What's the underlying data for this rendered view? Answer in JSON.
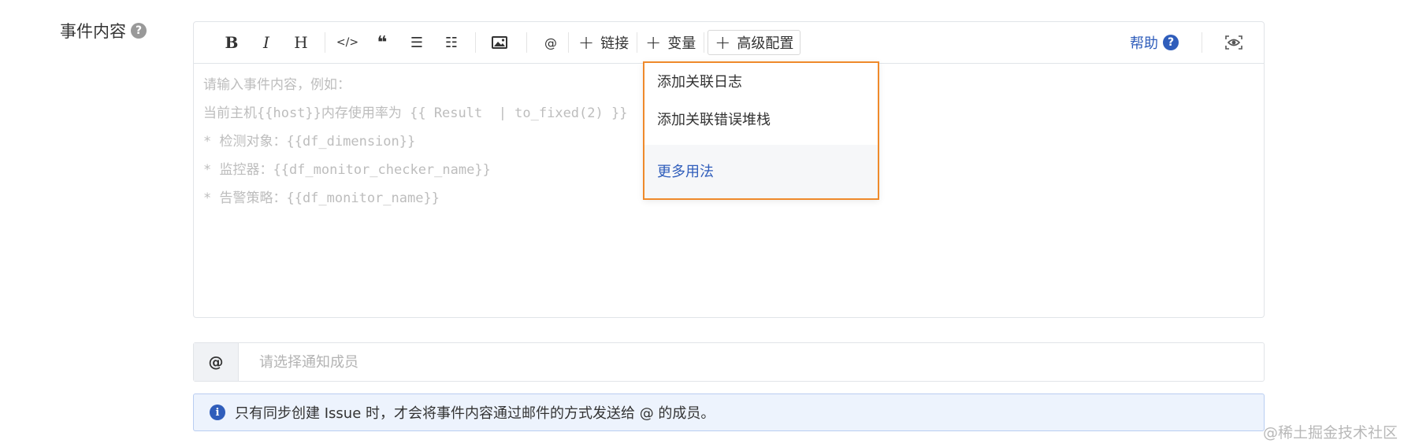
{
  "field": {
    "label": "事件内容",
    "help_glyph": "?"
  },
  "toolbar": {
    "bold": "B",
    "italic": "I",
    "heading": "H",
    "code": "</>",
    "quote": "❝",
    "ul": "☰",
    "ol": "☷",
    "mention": "@",
    "link_label": "链接",
    "variable_label": "变量",
    "advanced_label": "高级配置",
    "plus": "+",
    "help_label": "帮助",
    "help_glyph": "?"
  },
  "editor": {
    "placeholder_lines": [
      "请输入事件内容，例如：",
      "当前主机{{host}}内存使用率为 {{ Result  | to_fixed(2) }}",
      "* 检测对象：{{df_dimension}}",
      "* 监控器：{{df_monitor_checker_name}}",
      "* 告警策略：{{df_monitor_name}}"
    ]
  },
  "dropdown": {
    "items": [
      "添加关联日志",
      "添加关联错误堆栈"
    ],
    "more_label": "更多用法"
  },
  "members": {
    "at_label": "@",
    "placeholder": "请选择通知成员"
  },
  "info": {
    "glyph": "i",
    "text": "只有同步创建 Issue 时，才会将事件内容通过邮件的方式发送给 @ 的成员。"
  },
  "watermark": "@稀土掘金技术社区",
  "icons": {
    "image": "image-icon",
    "preview": "eye-icon",
    "help": "question-circle-icon",
    "info": "info-circle-icon"
  },
  "colors": {
    "accent": "#2f5dbb",
    "dropdown_border": "#ef8a2b",
    "info_bg": "#edf3fd"
  }
}
